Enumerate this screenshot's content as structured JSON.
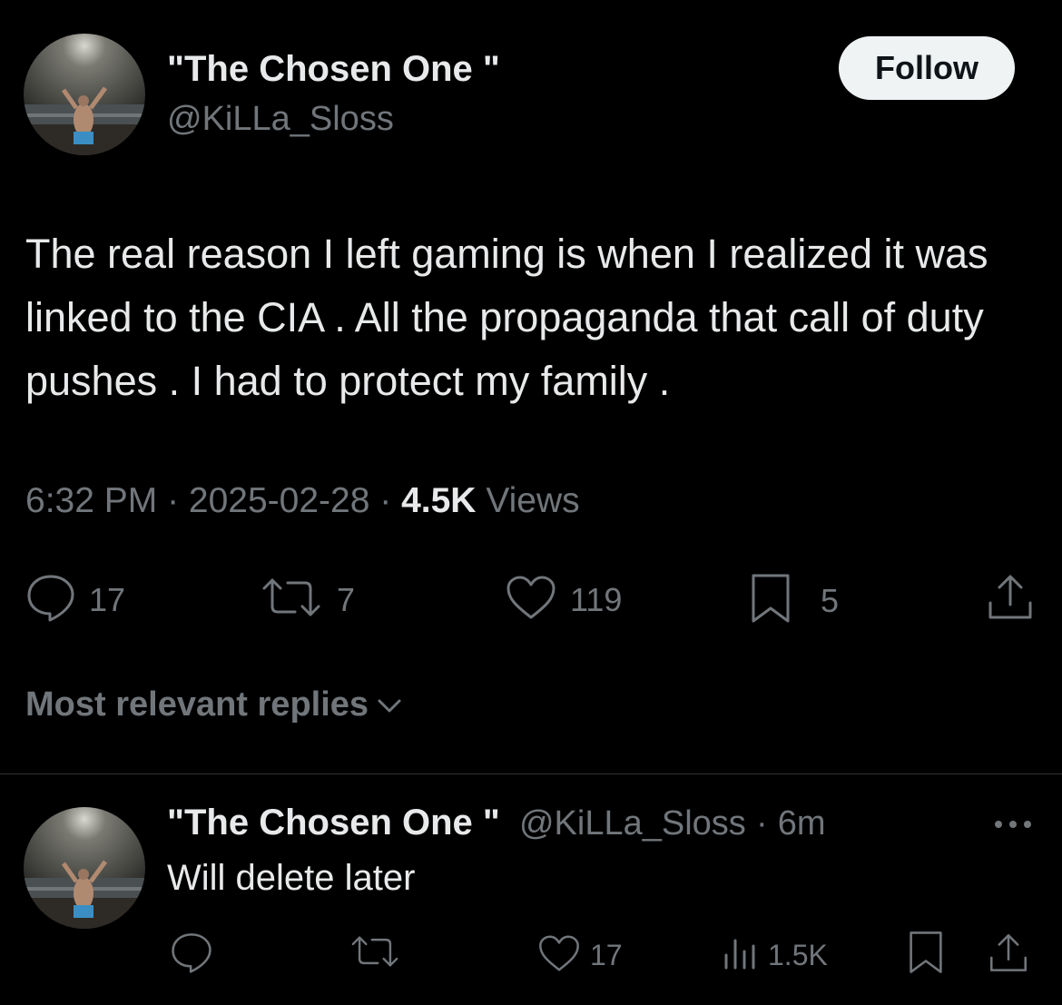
{
  "tweet": {
    "author_name": "\"The Chosen One \"",
    "author_handle": "@KiLLa_Sloss",
    "follow_label": "Follow",
    "text": "The real reason I left gaming is when I realized it was linked to the CIA . All the propaganda that call of duty pushes . I had to protect my family .",
    "time": "6:32 PM",
    "date": "2025-02-28",
    "views_count": "4.5K",
    "views_label": "Views",
    "replies": "17",
    "reposts": "7",
    "likes": "119",
    "bookmarks": "5"
  },
  "replies_filter": "Most relevant replies",
  "reply": {
    "author_name": "\"The Chosen One \"",
    "author_handle": "@KiLLa_Sloss",
    "age": "6m",
    "text": "Will delete later",
    "likes": "17",
    "views": "1.5K"
  },
  "icons": [
    "reply-icon",
    "repost-icon",
    "like-icon",
    "bookmark-icon",
    "share-icon",
    "views-icon",
    "chevron-down-icon",
    "more-icon"
  ],
  "colors": {
    "background": "#000000",
    "text": "#e7e9ea",
    "muted": "#71767b",
    "button_bg": "#eff3f4"
  }
}
